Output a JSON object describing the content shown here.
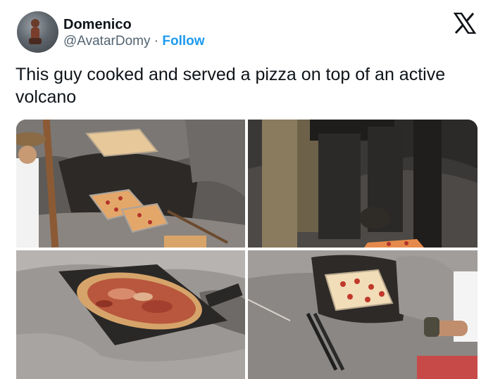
{
  "author": {
    "display_name": "Domenico",
    "handle": "@AvatarDomy",
    "separator": "·",
    "follow_label": "Follow"
  },
  "tweet": {
    "text": "This guy cooked and served a pizza on top of an active volcano"
  },
  "media": {
    "count": 4
  },
  "icons": {
    "platform_logo": "x-logo-icon"
  },
  "colors": {
    "follow": "#1d9bf0",
    "handle": "#536471",
    "text": "#0f1419"
  }
}
